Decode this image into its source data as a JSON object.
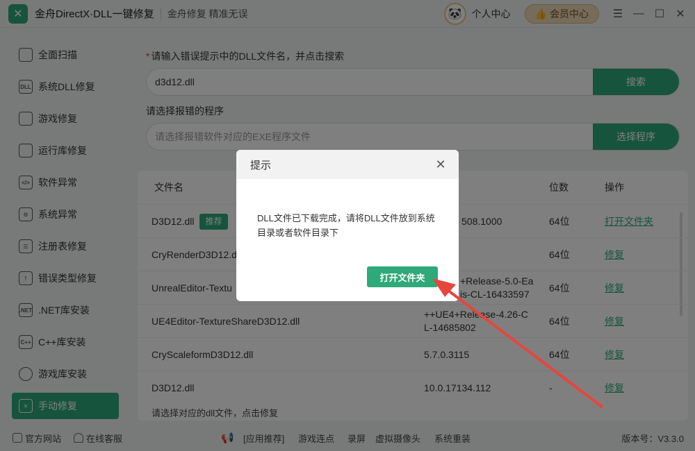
{
  "app": {
    "title": "金舟DirectX·DLL一键修复",
    "slogan": "金舟修复 精准无误",
    "user_center": "个人中心",
    "vip": "会员中心"
  },
  "sidebar": {
    "items": [
      {
        "label": "全面扫描",
        "icon": "scan-icon"
      },
      {
        "label": "系统DLL修复",
        "icon": "dll-icon"
      },
      {
        "label": "游戏修复",
        "icon": "gamepad-icon"
      },
      {
        "label": "运行库修复",
        "icon": "vs-icon"
      },
      {
        "label": "软件异常",
        "icon": "code-icon"
      },
      {
        "label": "系统异常",
        "icon": "gear-icon"
      },
      {
        "label": "注册表修复",
        "icon": "list-icon"
      },
      {
        "label": "错误类型修复",
        "icon": "warning-icon"
      },
      {
        "label": ".NET库安装",
        "icon": "net-icon"
      },
      {
        "label": "C++库安装",
        "icon": "cpp-icon"
      },
      {
        "label": "游戏库安装",
        "icon": "pacman-icon"
      },
      {
        "label": "手动修复",
        "icon": "wrench-icon"
      }
    ]
  },
  "main": {
    "dll_label_star": "*",
    "dll_label": "请输入错误提示中的DLL文件名，并点击搜索",
    "dll_value": "d3d12.dll",
    "search_btn": "搜索",
    "program_label": "请选择报错的程序",
    "program_placeholder": "请选择报错软件对应的EXE程序文件",
    "select_btn": "选择程序"
  },
  "table": {
    "headers": {
      "name": "文件名",
      "bits": "位数",
      "action": "操作"
    },
    "rows": [
      {
        "name": "D3D12.dll",
        "badge": "推荐",
        "version": "508.1000",
        "bits": "64位",
        "action": "打开文件夹"
      },
      {
        "name": "CryRenderD3D12.d",
        "version": "",
        "bits": "64位",
        "action": "修复"
      },
      {
        "name": "UnrealEditor-Textu",
        "version": "+Release-5.0-Ea\nis-CL-16433597",
        "bits": "64位",
        "action": "修复"
      },
      {
        "name": "UE4Editor-TextureShareD3D12.dll",
        "version": "++UE4+Release-4.26-C\nL-14685802",
        "bits": "64位",
        "action": "修复"
      },
      {
        "name": "CryScaleformD3D12.dll",
        "version": "5.7.0.3115",
        "bits": "64位",
        "action": "修复"
      },
      {
        "name": "D3D12.dll",
        "version": "10.0.17134.112",
        "bits": "-",
        "action": "修复"
      }
    ],
    "hint": "请选择对应的dll文件，点击修复"
  },
  "footer": {
    "website": "官方网站",
    "service": "在线客服",
    "recommend": "[应用推荐]",
    "links": [
      "游戏连点",
      "录屏",
      "虚拟摄像头",
      "系统重装"
    ],
    "version": "版本号：V3.3.0"
  },
  "dialog": {
    "title": "提示",
    "message": "DLL文件已下载完成，请将DLL文件放到系统目录或者软件目录下",
    "button": "打开文件夹"
  },
  "colors": {
    "accent": "#2ea97a",
    "arrow": "#e8453c"
  }
}
